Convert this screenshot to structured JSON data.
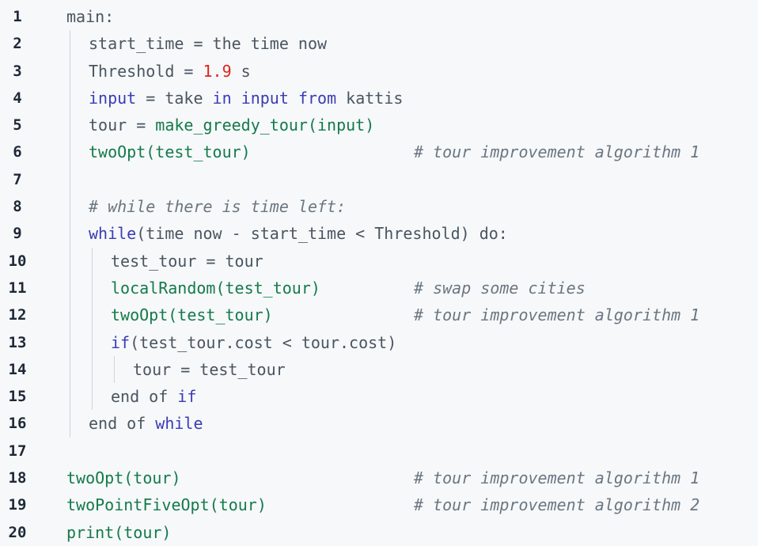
{
  "lines": [
    {
      "num": "1",
      "indent": 0,
      "segments": [
        {
          "t": "main:",
          "c": "plain"
        }
      ],
      "comment": ""
    },
    {
      "num": "2",
      "indent": 1,
      "segments": [
        {
          "t": "start_time = the time now",
          "c": "plain"
        }
      ],
      "comment": ""
    },
    {
      "num": "3",
      "indent": 1,
      "segments": [
        {
          "t": "Threshold = ",
          "c": "plain"
        },
        {
          "t": "1.9",
          "c": "num"
        },
        {
          "t": " s",
          "c": "plain"
        }
      ],
      "comment": ""
    },
    {
      "num": "4",
      "indent": 1,
      "segments": [
        {
          "t": "input",
          "c": "kw"
        },
        {
          "t": " = take ",
          "c": "plain"
        },
        {
          "t": "in",
          "c": "kw"
        },
        {
          "t": " ",
          "c": "plain"
        },
        {
          "t": "input",
          "c": "kw"
        },
        {
          "t": " ",
          "c": "plain"
        },
        {
          "t": "from",
          "c": "kw"
        },
        {
          "t": " kattis",
          "c": "plain"
        }
      ],
      "comment": ""
    },
    {
      "num": "5",
      "indent": 1,
      "segments": [
        {
          "t": "tour = ",
          "c": "plain"
        },
        {
          "t": "make_greedy_tour(input)",
          "c": "fn"
        }
      ],
      "comment": ""
    },
    {
      "num": "6",
      "indent": 1,
      "segments": [
        {
          "t": "twoOpt(test_tour)",
          "c": "fn"
        }
      ],
      "comment": "# tour improvement algorithm 1"
    },
    {
      "num": "7",
      "indent": 1,
      "segments": [],
      "comment": ""
    },
    {
      "num": "8",
      "indent": 1,
      "segments": [
        {
          "t": "# while there is time left:",
          "c": "cmt"
        }
      ],
      "comment": ""
    },
    {
      "num": "9",
      "indent": 1,
      "segments": [
        {
          "t": "while",
          "c": "kw"
        },
        {
          "t": "(time now - start_time < Threshold) do:",
          "c": "plain"
        }
      ],
      "comment": ""
    },
    {
      "num": "10",
      "indent": 2,
      "segments": [
        {
          "t": "test_tour = tour",
          "c": "plain"
        }
      ],
      "comment": ""
    },
    {
      "num": "11",
      "indent": 2,
      "segments": [
        {
          "t": "localRandom(test_tour)",
          "c": "fn"
        }
      ],
      "comment": "# swap some cities"
    },
    {
      "num": "12",
      "indent": 2,
      "segments": [
        {
          "t": "twoOpt(test_tour)",
          "c": "fn"
        }
      ],
      "comment": "# tour improvement algorithm 1"
    },
    {
      "num": "13",
      "indent": 2,
      "segments": [
        {
          "t": "if",
          "c": "kw"
        },
        {
          "t": "(test_tour.cost < tour.cost)",
          "c": "plain"
        }
      ],
      "comment": ""
    },
    {
      "num": "14",
      "indent": 3,
      "segments": [
        {
          "t": "tour = test_tour",
          "c": "plain"
        }
      ],
      "comment": ""
    },
    {
      "num": "15",
      "indent": 2,
      "segments": [
        {
          "t": "end of ",
          "c": "plain"
        },
        {
          "t": "if",
          "c": "kw"
        }
      ],
      "comment": ""
    },
    {
      "num": "16",
      "indent": 1,
      "segments": [
        {
          "t": "end of ",
          "c": "plain"
        },
        {
          "t": "while",
          "c": "kw"
        }
      ],
      "comment": ""
    },
    {
      "num": "17",
      "indent": 0,
      "segments": [],
      "comment": ""
    },
    {
      "num": "18",
      "indent": 0,
      "segments": [
        {
          "t": "twoOpt(tour)",
          "c": "fn"
        }
      ],
      "comment": "# tour improvement algorithm 1"
    },
    {
      "num": "19",
      "indent": 0,
      "segments": [
        {
          "t": "twoPointFiveOpt(tour)",
          "c": "fn"
        }
      ],
      "comment": "# tour improvement algorithm 2"
    },
    {
      "num": "20",
      "indent": 0,
      "segments": [
        {
          "t": "print(tour)",
          "c": "fn"
        }
      ],
      "comment": ""
    }
  ],
  "colors": {
    "background": "#f6f8fa",
    "keyword": "#3b3bb5",
    "function": "#147a4a",
    "number": "#e0241b",
    "comment": "#6b7680",
    "text": "#4a5560",
    "line_number": "#1f2937"
  }
}
